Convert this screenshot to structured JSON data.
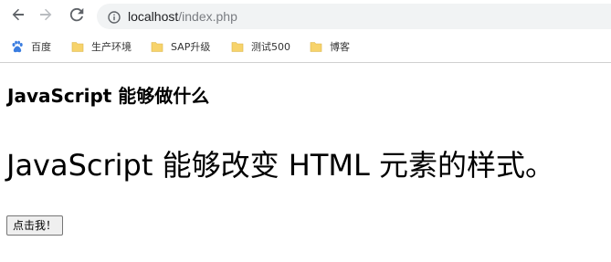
{
  "browser": {
    "url_host": "localhost",
    "url_path": "/index.php",
    "nav": {
      "back_icon": "arrow-left-icon",
      "forward_icon": "arrow-right-icon",
      "reload_icon": "reload-icon",
      "info_icon": "info-icon"
    },
    "bookmarks": [
      {
        "label": "百度",
        "icon": "paw-icon"
      },
      {
        "label": "生产环境",
        "icon": "folder-icon"
      },
      {
        "label": "SAP升级",
        "icon": "folder-icon"
      },
      {
        "label": "测试500",
        "icon": "folder-icon"
      },
      {
        "label": "博客",
        "icon": "folder-icon"
      }
    ]
  },
  "page": {
    "heading": "JavaScript 能够做什么",
    "paragraph": "JavaScript 能够改变 HTML 元素的样式。",
    "button_label": "点击我！"
  },
  "colors": {
    "folder": "#f7d36b",
    "paw": "#3b7de0",
    "url_path": "#7a7d82"
  }
}
